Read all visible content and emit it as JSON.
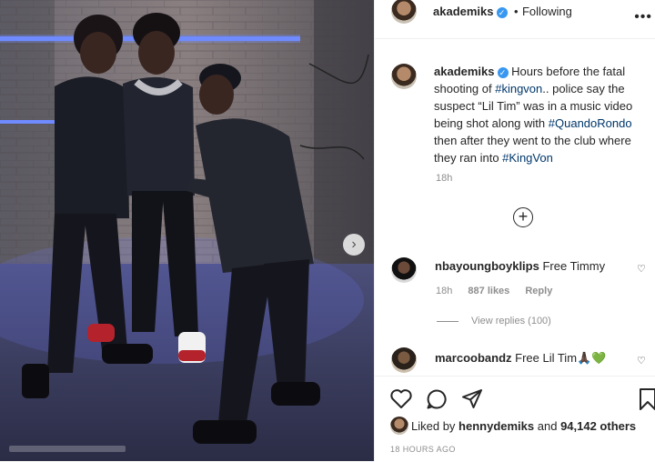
{
  "post": {
    "author": "akademiks",
    "follow_separator": "•",
    "follow_label": "Following",
    "more_icon": "more-horizontal-icon",
    "caption_author": "akademiks",
    "caption": {
      "part1": " Hours before the fatal shooting of ",
      "tag1": "#kingvon",
      "part2": ".. police say the suspect “Lil Tim” was in a music video being shot along with ",
      "tag2": "#QuandoRondo",
      "part3": " then after they went to the club where they ran into ",
      "tag3": "#KingVon"
    },
    "caption_time": "18h",
    "load_more_icon": "plus-circle-icon"
  },
  "comments": [
    {
      "username": "nbayoungboyklips",
      "text": " Free Timmy",
      "time": "18h",
      "likes": "887 likes",
      "reply_label": "Reply",
      "view_replies": "View replies (100)"
    },
    {
      "username": "marcoobandz",
      "text": " Free Lil Tim",
      "emoji": "🙏🏿💚"
    }
  ],
  "footer": {
    "liked_by_prefix": "Liked by ",
    "liked_by_user": "hennydemiks",
    "liked_by_mid": " and ",
    "liked_by_count": "94,142 others",
    "post_time": "18 HOURS AGO"
  },
  "media": {
    "next_icon": "chevron-right-icon",
    "next_glyph": "›"
  },
  "colors": {
    "link": "#00376b",
    "verified": "#3897f0",
    "neon": "#4a6cff"
  }
}
